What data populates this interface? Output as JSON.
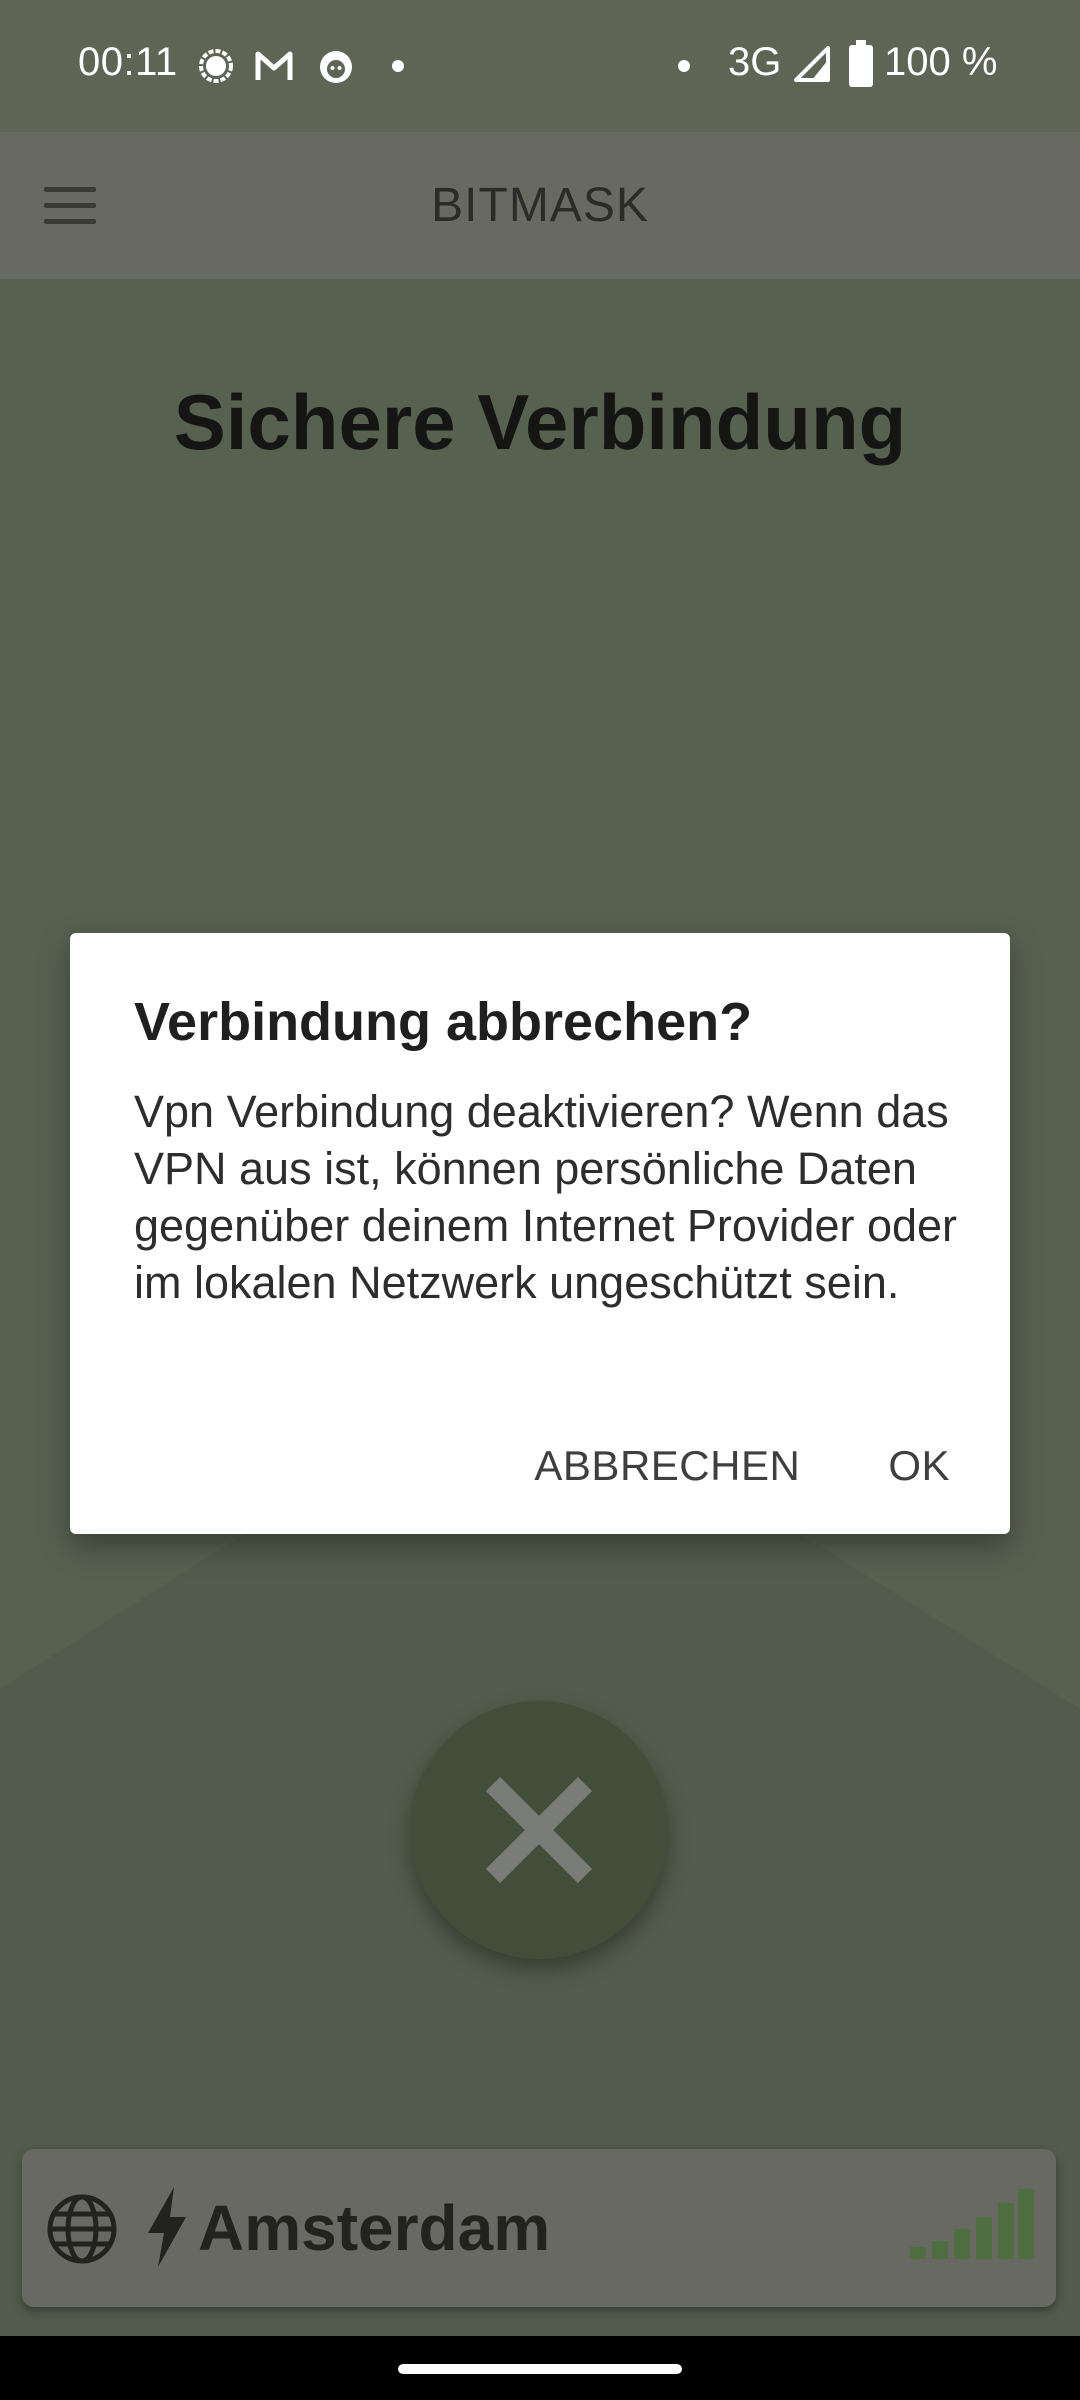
{
  "status_bar": {
    "time": "00:11",
    "network": "3G",
    "battery": "100 %",
    "notification_icons": [
      "signal-messenger-icon",
      "gmail-icon",
      "github-icon"
    ]
  },
  "app_bar": {
    "title": "BITMASK",
    "menu_icon": "hamburger-menu-icon"
  },
  "main": {
    "heading": "Sichere Verbindung",
    "disconnect_icon": "close-x-icon",
    "location": {
      "name": "Amsterdam",
      "globe_icon": "globe-icon",
      "bolt_icon": "lightning-bolt-icon",
      "signal_icon": "signal-strength-icon"
    }
  },
  "dialog": {
    "title": "Verbindung abbrechen?",
    "message": "Vpn Verbindung deaktivieren? Wenn das VPN aus ist, können persönliche Daten gegenüber deinem Internet Provider oder im lokalen Netzwerk ungeschützt sein.",
    "cancel_label": "ABBRECHEN",
    "ok_label": "OK"
  },
  "colors": {
    "background": "#576150",
    "app_bar": "#686a61",
    "status_bar": "#5e6555",
    "button_green": "#424e39",
    "signal_green": "#4f6e3f",
    "dialog": "#ffffff"
  }
}
